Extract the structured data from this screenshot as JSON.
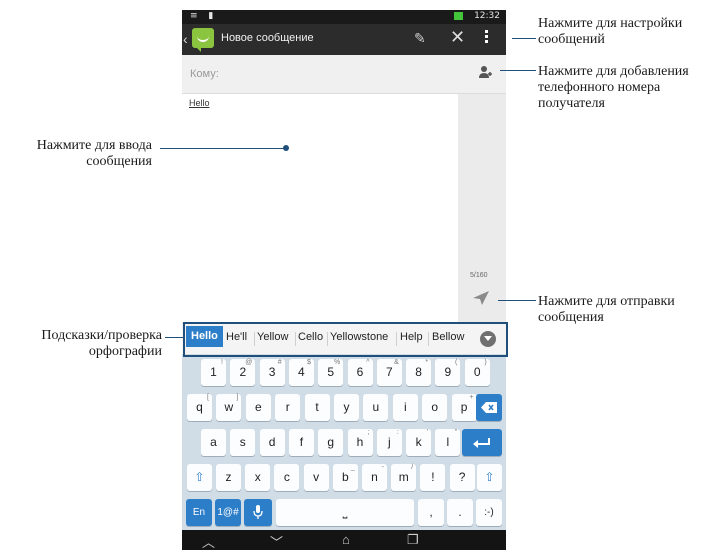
{
  "statusbar": {
    "left_icons": "≡ ▮",
    "right_icons": "✗ ≋ ▮▮ ▤",
    "time": "12:32"
  },
  "actionbar": {
    "title": "Новое сообщение"
  },
  "recipient": {
    "placeholder": "Кому:"
  },
  "message": {
    "text": "Hello",
    "counter": "5/160"
  },
  "suggestions": [
    "Hello",
    "He'll",
    "Yellow",
    "Cello",
    "Yellowstone",
    "Help",
    "Bellow"
  ],
  "keyboard": {
    "row1": [
      [
        "1",
        "!"
      ],
      [
        "2",
        "@"
      ],
      [
        "3",
        "#"
      ],
      [
        "4",
        "$"
      ],
      [
        "5",
        "%"
      ],
      [
        "6",
        "^"
      ],
      [
        "7",
        "&"
      ],
      [
        "8",
        "*"
      ],
      [
        "9",
        "("
      ],
      [
        "0",
        ")"
      ]
    ],
    "row2": [
      [
        "q",
        "["
      ],
      [
        "w",
        "]"
      ],
      [
        "e",
        ""
      ],
      [
        "r",
        ""
      ],
      [
        "t",
        ""
      ],
      [
        "y",
        ""
      ],
      [
        "u",
        ""
      ],
      [
        "i",
        ""
      ],
      [
        "o",
        ""
      ],
      [
        "p",
        "+"
      ]
    ],
    "row3": [
      [
        "a",
        ""
      ],
      [
        "s",
        ""
      ],
      [
        "d",
        ""
      ],
      [
        "f",
        ""
      ],
      [
        "g",
        ""
      ],
      [
        "h",
        ";"
      ],
      [
        "j",
        ":"
      ],
      [
        "k",
        "'"
      ],
      [
        "l",
        "\""
      ]
    ],
    "row4": [
      [
        "z",
        ""
      ],
      [
        "x",
        ""
      ],
      [
        "c",
        ""
      ],
      [
        "v",
        ""
      ],
      [
        "b",
        "_"
      ],
      [
        "n",
        "-"
      ],
      [
        "m",
        "/"
      ],
      [
        "!",
        ""
      ],
      [
        "?",
        ""
      ]
    ],
    "lang": "En",
    "symbols": "1@#",
    "comma": ",",
    "period": ".",
    "smiley": ":-)"
  },
  "callouts": {
    "settings": "Нажмите для настройки сообщений",
    "add_number": "Нажмите для добавления телефонного номера получателя",
    "type_message": "Нажмите для ввода сообщения",
    "send": "Нажмите для отправки сообщения",
    "spell": "Подсказки/проверка орфографии"
  },
  "colors": {
    "accent": "#2d7ec8",
    "callout_line": "#1f4f7a",
    "app_green": "#8bc53f"
  }
}
